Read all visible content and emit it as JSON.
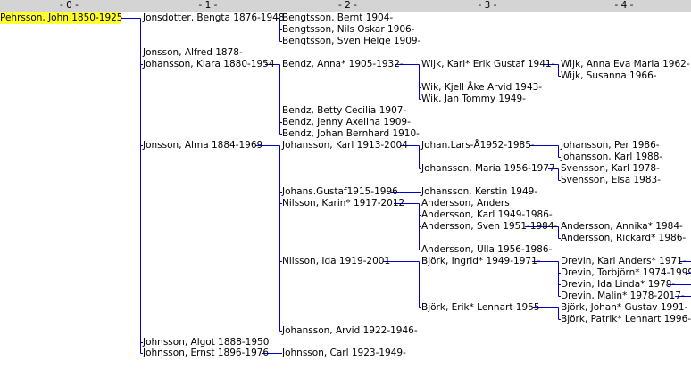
{
  "columns": [
    "- 0 -",
    "- 1 -",
    "- 2 -",
    "- 3 -",
    "- 4 -"
  ],
  "nodes": {
    "n0": "Pehrsson, John 1850-1925",
    "g1_1": "Jonsdotter, Bengta 1876-1948",
    "g1_2": "Jonsson, Alfred 1878-",
    "g1_3": "Johansson, Klara 1880-1954",
    "g1_4": "Jonsson, Alma 1884-1969",
    "g1_5": "Johnsson, Algot 1888-1950",
    "g1_6": "Johnsson, Ernst 1896-1976",
    "g2_1": "Bengtsson, Bernt 1904-",
    "g2_2": "Bengtsson, Nils Oskar 1906-",
    "g2_3": "Bengtsson, Sven Helge 1909-",
    "g2_4": "Bendz, Anna* 1905-1932-",
    "g2_5": "Bendz, Betty Cecilia 1907-",
    "g2_6": "Bendz, Jenny Axelina 1909-",
    "g2_7": "Bendz, Johan Bernhard 1910-",
    "g2_8": "Johansson, Karl 1913-2004",
    "g2_9": "Johans.Gustaf1915-1996",
    "g2_10": "Nilsson, Karin* 1917-2012",
    "g2_11": "Nilsson, Ida 1919-2001",
    "g2_12": "Johansson, Arvid 1922-1946-",
    "g2_13": "Johnsson, Carl 1923-1949-",
    "g3_1": "Wijk, Karl* Erik Gustaf 1941-",
    "g3_2": "Wik, Kjell Åke Arvid 1943-",
    "g3_3": "Wik, Jan Tommy 1949-",
    "g3_4": "Johan.Lars-Å1952-1985-",
    "g3_5": "Johansson, Maria 1956-1977-",
    "g3_6": "Johansson, Kerstin 1949-",
    "g3_7": "Andersson, Anders",
    "g3_8": "Andersson, Karl 1949-1986-",
    "g3_9": "Andersson, Sven 1951-1984-",
    "g3_10": "Andersson, Ulla 1956-1986-",
    "g3_11": "Björk, Ingrid* 1949-1971-",
    "g3_12": "Björk, Erik* Lennart 1955-",
    "g4_1": "Wijk, Anna Eva Maria 1962-",
    "g4_2": "Wijk, Susanna 1966-",
    "g4_3": "Johansson, Per 1986-",
    "g4_4": "Johansson, Karl 1988-",
    "g4_5": "Svensson, Karl 1978-",
    "g4_6": "Svensson, Elsa 1983-",
    "g4_7": "Andersson, Annika* 1984-",
    "g4_8": "Andersson, Rickard* 1986-",
    "g4_9": "Drevin, Karl Anders* 1971-",
    "g4_10": "Drevin, Torbjörn* 1974-1999",
    "g4_11": "Drevin, Ida Linda* 1978-",
    "g4_12": "Drevin, Malin* 1978-2017-",
    "g4_13": "Björk, Johan* Gustav 1991-",
    "g4_14": "Björk, Patrik* Lennart 1996-"
  },
  "colors": {
    "header_bg": "#d4d4d4",
    "selected_bg": "#ffff33",
    "connector": "#0000cc"
  }
}
